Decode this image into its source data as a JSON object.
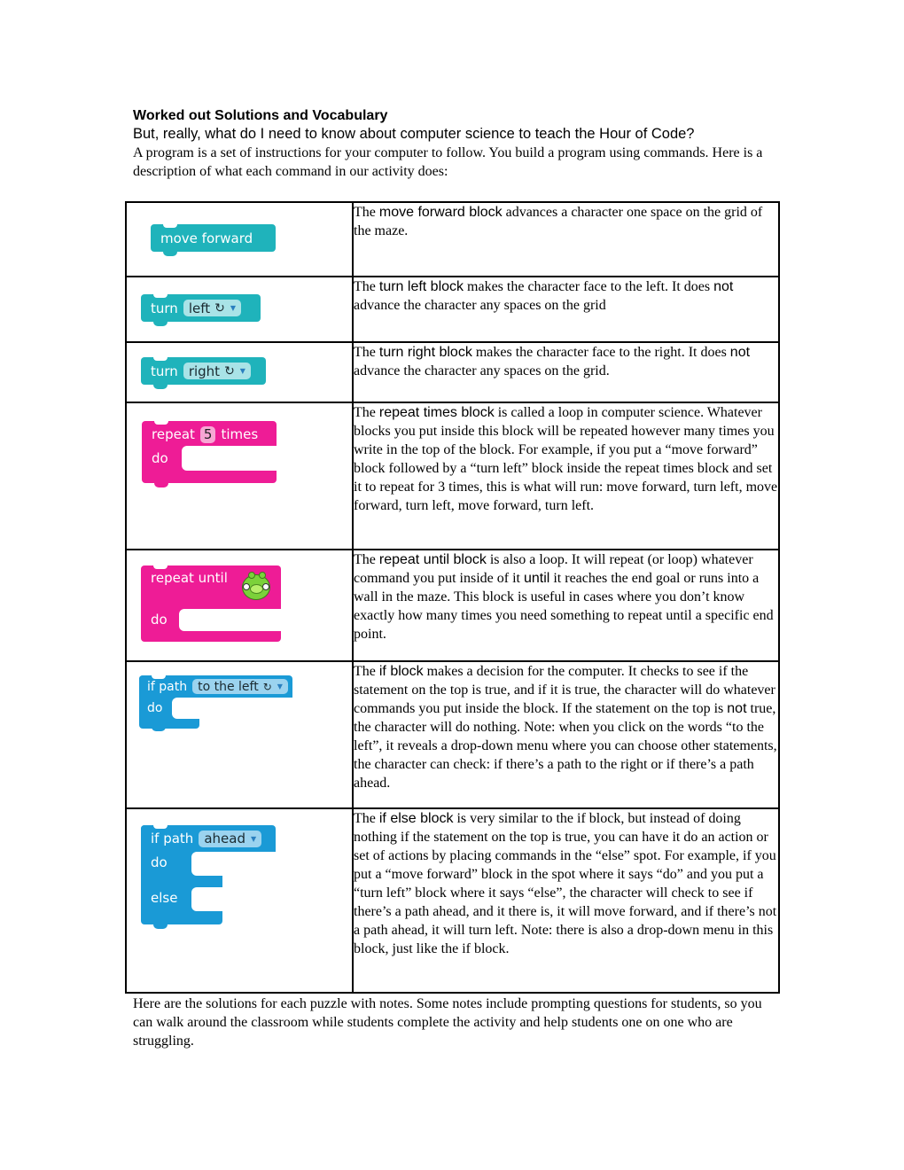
{
  "header": {
    "title": "Worked out Solutions and Vocabulary",
    "subtitle": "But, really, what do I need to know about computer science to teach the Hour of Code?",
    "intro": "A program is a set of instructions for your computer to follow. You build a program using commands. Here is a description of what each command in our activity does:"
  },
  "commands": [
    {
      "block": {
        "label": "move forward",
        "color": "#1fb3bb"
      },
      "desc": {
        "pre": "The ",
        "term": "move forward block",
        "post": " advances a character one space on the grid of the maze."
      }
    },
    {
      "block": {
        "label": "turn",
        "option": "left",
        "icon": "rotate-left-icon",
        "color": "#1fb3bb"
      },
      "desc": {
        "pre": "The ",
        "term": "turn left block",
        "mid": " makes the character face to the left. It does ",
        "emph": "not",
        "post": " advance the character any spaces on the grid"
      }
    },
    {
      "block": {
        "label": "turn",
        "option": "right",
        "icon": "rotate-right-icon",
        "color": "#1fb3bb"
      },
      "desc": {
        "pre": "The ",
        "term": "turn right block",
        "mid": " makes the character face to the right. It does ",
        "emph": "not",
        "post": " advance the character any spaces on the grid."
      }
    },
    {
      "block": {
        "label": "repeat",
        "count": "5",
        "label2": "times",
        "do": "do",
        "color": "#ee1c96"
      },
      "desc": {
        "pre": "The ",
        "term": "repeat times block",
        "post": " is called a loop in computer science. Whatever blocks you put inside this block will be repeated however many times you write in the top of the block. For example, if you put a “move forward” block followed by a “turn left” block inside the repeat times block and set it to repeat for 3 times, this is what will run: move forward, turn left, move forward, turn left, move forward, turn left."
      }
    },
    {
      "block": {
        "label": "repeat until",
        "icon": "pig-goal-icon",
        "do": "do",
        "color": "#ee1c96"
      },
      "desc": {
        "pre": "The ",
        "term": "repeat until block",
        "mid": " is also a loop. It will repeat (or loop) whatever command you put inside of it ",
        "emph": "until",
        "post": " it reaches the end goal or runs into a wall in the maze. This block is useful in cases where you don’t know exactly how many times you need something to repeat until a specific end point."
      }
    },
    {
      "block": {
        "label": "if path",
        "option": "to the left",
        "icon": "rotate-left-icon",
        "do": "do",
        "color": "#1a9ad6"
      },
      "desc": {
        "pre": "The ",
        "term": "if block",
        "mid": " makes a decision for the computer. It checks to see if the statement on the top is true, and if it is true, the character will do whatever commands you put inside the block. If the statement on the top is ",
        "emph": "not",
        "post": " true, the character will do nothing. Note: when you click on the words “to the left”, it reveals a drop-down menu where you can choose other statements, the character can check: if there’s a path to the right or if there’s a path ahead."
      }
    },
    {
      "block": {
        "label": "if path",
        "option": "ahead",
        "do": "do",
        "else": "else",
        "color": "#1a9ad6"
      },
      "desc": {
        "pre": "The ",
        "term": "if else block",
        "post": " is very similar to the if block, but instead of doing nothing if the statement on the top is true, you can have it do an action or set of actions by placing commands in the “else” spot. For example, if you put a “move forward” block in the spot where it says “do” and you put a “turn left” block where it says “else”, the character will check to see if there’s a path ahead, and it there is, it will move forward, and if there’s not a path ahead, it will turn left. Note: there is also a drop-down menu in this block, just like the if block."
      }
    }
  ],
  "outro": "Here are the solutions for each puzzle with notes. Some notes include prompting questions for students, so you can walk around the classroom while students complete the activity and help students one on one who are struggling.",
  "glyphs": {
    "rotate": "↻",
    "dropdown": "▼"
  }
}
